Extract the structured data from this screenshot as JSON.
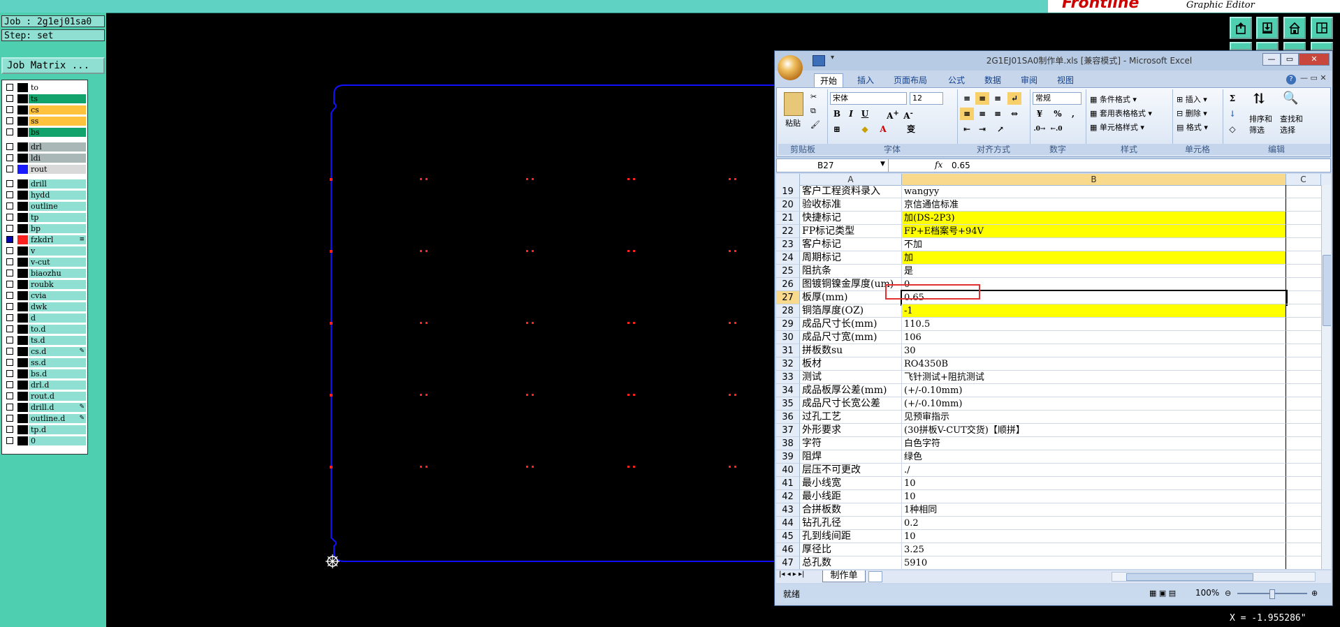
{
  "app": {
    "brand_logo": "Frontline",
    "brand_subtitle": "Graphic Editor"
  },
  "left_panel": {
    "job": "Job : 2g1ej01sa0",
    "step": "Step: set",
    "job_matrix_button": "Job Matrix ...",
    "layers": [
      {
        "name": "to",
        "color": "#ffffff",
        "swatch": "#000000",
        "checked": false,
        "mark": ""
      },
      {
        "name": "ts",
        "color": "#11a36b",
        "swatch": "#000000",
        "checked": false,
        "mark": ""
      },
      {
        "name": "cs",
        "color": "#ffc23d",
        "swatch": "#000000",
        "checked": false,
        "mark": ""
      },
      {
        "name": "ss",
        "color": "#ffc23d",
        "swatch": "#000000",
        "checked": false,
        "mark": ""
      },
      {
        "name": "bs",
        "color": "#11a36b",
        "swatch": "#000000",
        "checked": false,
        "mark": ""
      },
      {
        "name": "drl",
        "color": "#a9b8b6",
        "swatch": "#000000",
        "checked": false,
        "mark": ""
      },
      {
        "name": "ldi",
        "color": "#a9b8b6",
        "swatch": "#000000",
        "checked": false,
        "mark": ""
      },
      {
        "name": "rout",
        "color": "#d9d9d9",
        "swatch": "#1a1aff",
        "checked": false,
        "mark": ""
      },
      {
        "name": "drill",
        "color": "#8fe0d2",
        "swatch": "#000000",
        "checked": false,
        "mark": ""
      },
      {
        "name": "hydd",
        "color": "#8fe0d2",
        "swatch": "#000000",
        "checked": false,
        "mark": ""
      },
      {
        "name": "outline",
        "color": "#8fe0d2",
        "swatch": "#000000",
        "checked": false,
        "mark": ""
      },
      {
        "name": "tp",
        "color": "#8fe0d2",
        "swatch": "#000000",
        "checked": false,
        "mark": ""
      },
      {
        "name": "bp",
        "color": "#8fe0d2",
        "swatch": "#000000",
        "checked": false,
        "mark": ""
      },
      {
        "name": "fzkdrl",
        "color": "#8fe0d2",
        "swatch": "#ff2020",
        "checked": true,
        "mark": "≡"
      },
      {
        "name": "v",
        "color": "#8fe0d2",
        "swatch": "#000000",
        "checked": false,
        "mark": ""
      },
      {
        "name": "v-cut",
        "color": "#8fe0d2",
        "swatch": "#000000",
        "checked": false,
        "mark": ""
      },
      {
        "name": "biaozhu",
        "color": "#8fe0d2",
        "swatch": "#000000",
        "checked": false,
        "mark": ""
      },
      {
        "name": "roubk",
        "color": "#8fe0d2",
        "swatch": "#000000",
        "checked": false,
        "mark": ""
      },
      {
        "name": "cvia",
        "color": "#8fe0d2",
        "swatch": "#000000",
        "checked": false,
        "mark": ""
      },
      {
        "name": "dwk",
        "color": "#8fe0d2",
        "swatch": "#000000",
        "checked": false,
        "mark": ""
      },
      {
        "name": "d",
        "color": "#8fe0d2",
        "swatch": "#000000",
        "checked": false,
        "mark": ""
      },
      {
        "name": "to.d",
        "color": "#8fe0d2",
        "swatch": "#000000",
        "checked": false,
        "mark": ""
      },
      {
        "name": "ts.d",
        "color": "#8fe0d2",
        "swatch": "#000000",
        "checked": false,
        "mark": ""
      },
      {
        "name": "cs.d",
        "color": "#8fe0d2",
        "swatch": "#000000",
        "checked": false,
        "mark": "✎"
      },
      {
        "name": "ss.d",
        "color": "#8fe0d2",
        "swatch": "#000000",
        "checked": false,
        "mark": ""
      },
      {
        "name": "bs.d",
        "color": "#8fe0d2",
        "swatch": "#000000",
        "checked": false,
        "mark": ""
      },
      {
        "name": "drl.d",
        "color": "#8fe0d2",
        "swatch": "#000000",
        "checked": false,
        "mark": ""
      },
      {
        "name": "rout.d",
        "color": "#8fe0d2",
        "swatch": "#000000",
        "checked": false,
        "mark": ""
      },
      {
        "name": "drill.d",
        "color": "#8fe0d2",
        "swatch": "#000000",
        "checked": false,
        "mark": "✎"
      },
      {
        "name": "outline.d",
        "color": "#8fe0d2",
        "swatch": "#000000",
        "checked": false,
        "mark": "✎"
      },
      {
        "name": "tp.d",
        "color": "#8fe0d2",
        "swatch": "#000000",
        "checked": false,
        "mark": ""
      },
      {
        "name": "0",
        "color": "#8fe0d2",
        "swatch": "#000000",
        "checked": false,
        "mark": ""
      }
    ]
  },
  "toolbar_icons": [
    "export-up-icon",
    "save-down-icon",
    "home-icon",
    "panel-layout-icon"
  ],
  "coordinate_readout": "X = -1.955286\"",
  "excel": {
    "title": "2G1EJ01SA0制作单.xls [兼容模式] - Microsoft Excel",
    "ribbon_tabs": [
      "开始",
      "插入",
      "页面布局",
      "公式",
      "数据",
      "审阅",
      "视图"
    ],
    "active_tab": "开始",
    "groups": {
      "clipboard": {
        "name": "剪贴板",
        "paste": "粘贴"
      },
      "font": {
        "name": "字体",
        "font_name": "宋体",
        "font_size": "12"
      },
      "alignment": {
        "name": "对齐方式"
      },
      "number": {
        "name": "数字",
        "format": "常规"
      },
      "styles": {
        "name": "样式",
        "cond_format": "条件格式",
        "table_format": "套用表格格式",
        "cell_styles": "单元格样式"
      },
      "cells": {
        "name": "单元格",
        "insert": "插入",
        "delete": "删除",
        "format": "格式"
      },
      "editing": {
        "name": "编辑",
        "sort": "排序和",
        "filter": "筛选",
        "find": "查找和",
        "select": "选择"
      }
    },
    "name_box": "B27",
    "formula_value": "0.65",
    "columns": [
      "A",
      "B",
      "C"
    ],
    "rows": [
      {
        "n": "19",
        "a": "客户工程资料录入",
        "b": "wangyy",
        "yellow": false
      },
      {
        "n": "20",
        "a": "验收标准",
        "b": "京信通信标准",
        "yellow": false
      },
      {
        "n": "21",
        "a": "快捷标记",
        "b": "加(DS-2P3)",
        "yellow": true
      },
      {
        "n": "22",
        "a": "FP标记类型",
        "b": "FP+E档案号+94V",
        "yellow": true
      },
      {
        "n": "23",
        "a": "客户标记",
        "b": "不加",
        "yellow": false
      },
      {
        "n": "24",
        "a": "周期标记",
        "b": "加",
        "yellow": true
      },
      {
        "n": "25",
        "a": "阻抗条",
        "b": "是",
        "yellow": false
      },
      {
        "n": "26",
        "a": "图镀铜镍金厚度(um)",
        "b": "0",
        "yellow": false
      },
      {
        "n": "27",
        "a": "板厚(mm)",
        "b": "0.65",
        "yellow": false
      },
      {
        "n": "28",
        "a": "铜箔厚度(OZ)",
        "b": "-1",
        "yellow": true
      },
      {
        "n": "29",
        "a": "成品尺寸长(mm)",
        "b": "110.5",
        "yellow": false
      },
      {
        "n": "30",
        "a": "成品尺寸宽(mm)",
        "b": "106",
        "yellow": false
      },
      {
        "n": "31",
        "a": "拼板数su",
        "b": "30",
        "yellow": false
      },
      {
        "n": "32",
        "a": "板材",
        "b": "RO4350B",
        "yellow": false
      },
      {
        "n": "33",
        "a": "测试",
        "b": "飞针测试+阻抗测试",
        "yellow": false
      },
      {
        "n": "34",
        "a": "成品板厚公差(mm)",
        "b": "(+/-0.10mm)",
        "yellow": false
      },
      {
        "n": "35",
        "a": "成品尺寸长宽公差",
        "b": "(+/-0.10mm)",
        "yellow": false
      },
      {
        "n": "36",
        "a": "过孔工艺",
        "b": "见预审指示",
        "yellow": false
      },
      {
        "n": "37",
        "a": "外形要求",
        "b": "(30拼板V-CUT交货)【顺拼】",
        "yellow": false
      },
      {
        "n": "38",
        "a": "字符",
        "b": "白色字符",
        "yellow": false
      },
      {
        "n": "39",
        "a": "阻焊",
        "b": "绿色",
        "yellow": false
      },
      {
        "n": "40",
        "a": "层压不可更改",
        "b": "./",
        "yellow": false
      },
      {
        "n": "41",
        "a": "最小线宽",
        "b": "10",
        "yellow": false
      },
      {
        "n": "42",
        "a": "最小线距",
        "b": "10",
        "yellow": false
      },
      {
        "n": "43",
        "a": "合拼板数",
        "b": "1种相同",
        "yellow": false
      },
      {
        "n": "44",
        "a": "钻孔孔径",
        "b": "0.2",
        "yellow": false
      },
      {
        "n": "45",
        "a": "孔到线间距",
        "b": "10",
        "yellow": false
      },
      {
        "n": "46",
        "a": "厚径比",
        "b": "3.25",
        "yellow": false
      },
      {
        "n": "47",
        "a": "总孔数",
        "b": "5910",
        "yellow": false
      }
    ],
    "sheet_tab": "制作单",
    "status": "就绪",
    "zoom": "100%"
  }
}
